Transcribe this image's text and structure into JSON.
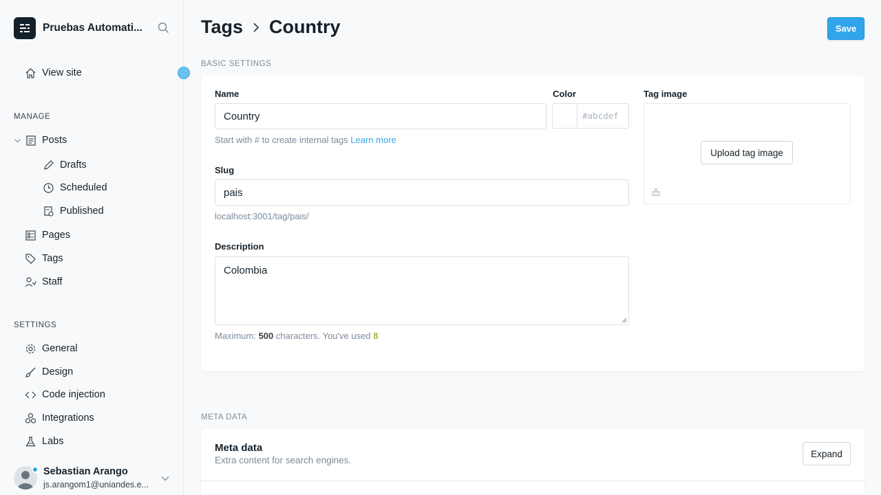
{
  "sidebar": {
    "site_title": "Pruebas Automati...",
    "view_site": "View site",
    "manage_title": "MANAGE",
    "posts": "Posts",
    "drafts": "Drafts",
    "scheduled": "Scheduled",
    "published": "Published",
    "pages": "Pages",
    "tags": "Tags",
    "staff": "Staff",
    "settings_title": "SETTINGS",
    "general": "General",
    "design": "Design",
    "code_injection": "Code injection",
    "integrations": "Integrations",
    "labs": "Labs",
    "user": {
      "name": "Sebastian Arango",
      "email": "js.arangom1@uniandes.e..."
    }
  },
  "header": {
    "crumb_parent": "Tags",
    "crumb_current": "Country",
    "save_label": "Save"
  },
  "basic": {
    "group_label": "BASIC SETTINGS",
    "name_label": "Name",
    "name_value": "Country",
    "name_hint": "Start with # to create internal tags",
    "learn_more": "Learn more",
    "color_label": "Color",
    "color_placeholder": "#abcdef",
    "tag_image_label": "Tag image",
    "upload_label": "Upload tag image",
    "slug_label": "Slug",
    "slug_value": "pais",
    "slug_url": "localhost:3001/tag/pais/",
    "description_label": "Description",
    "description_value": "Colombia",
    "desc_hint_prefix": "Maximum:",
    "desc_max": "500",
    "desc_hint_mid": "characters. You've used",
    "desc_used": "8"
  },
  "meta": {
    "group_label": "META DATA",
    "title": "Meta data",
    "subtitle": "Extra content for search engines.",
    "expand_label": "Expand"
  },
  "colors": {
    "accent": "#30a5ec",
    "text": "#15212a",
    "muted": "#7c8b9a",
    "count_green": "#9fba3b"
  },
  "icons": [
    "ghost-logo-icon",
    "search-icon",
    "home-icon",
    "chevron-down-icon",
    "posts-icon",
    "pencil-icon",
    "clock-icon",
    "published-icon",
    "pages-icon",
    "tag-icon",
    "staff-icon",
    "gear-icon",
    "brush-icon",
    "code-icon",
    "integrations-icon",
    "labs-icon",
    "chevron-right-icon",
    "image-icon"
  ]
}
